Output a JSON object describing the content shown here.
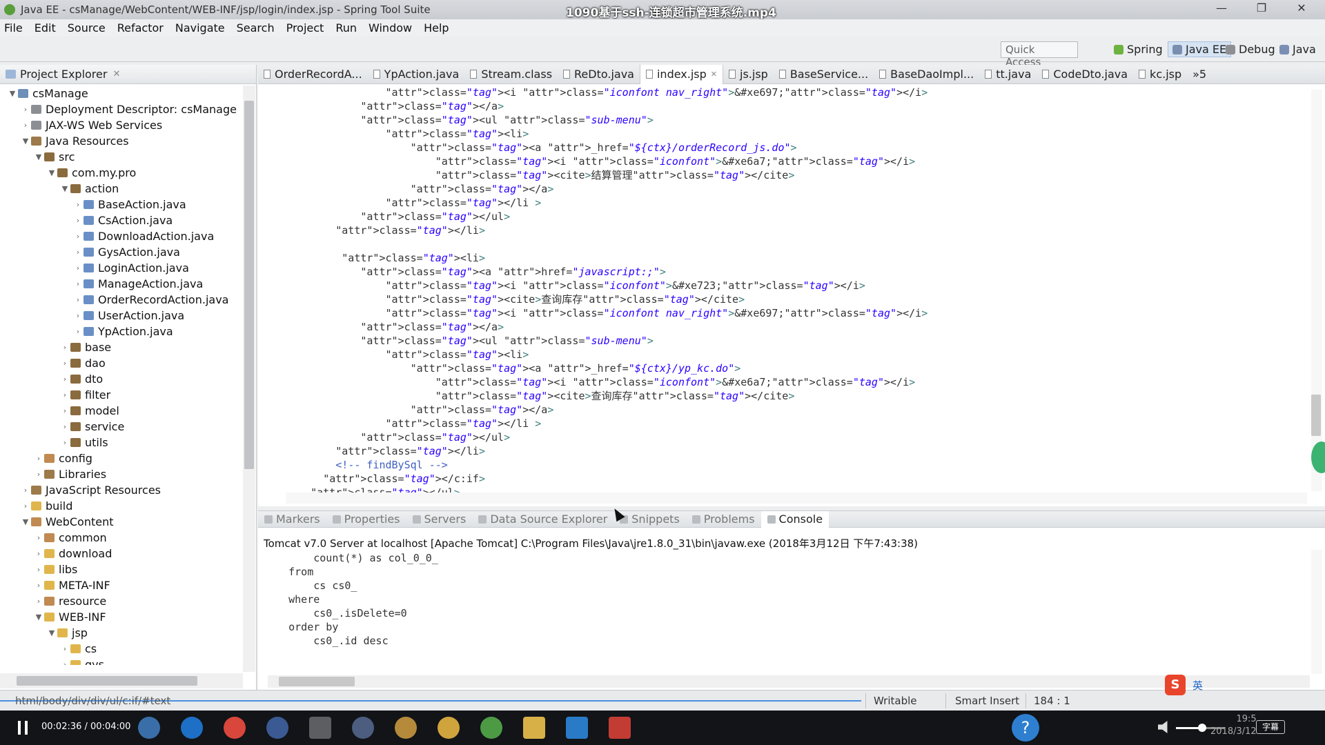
{
  "window": {
    "title": "Java EE - csManage/WebContent/WEB-INF/jsp/login/index.jsp - Spring Tool Suite",
    "video_title": "1090基于ssh-连锁超市管理系统.mp4"
  },
  "menu": [
    "File",
    "Edit",
    "Source",
    "Refactor",
    "Navigate",
    "Search",
    "Project",
    "Run",
    "Window",
    "Help"
  ],
  "toolbar": {
    "quick_access": "Quick Access",
    "perspectives": [
      "Spring",
      "Java EE",
      "Debug",
      "Java"
    ],
    "active_perspective": "Java EE"
  },
  "explorer": {
    "title": "Project Explorer",
    "tree": [
      {
        "label": "csManage",
        "icon": "proj",
        "twisty": "open"
      },
      {
        "label": "Deployment Descriptor: csManage",
        "icon": "dd",
        "twisty": "closed"
      },
      {
        "label": "JAX-WS Web Services",
        "icon": "dd",
        "twisty": "closed"
      },
      {
        "label": "Java Resources",
        "icon": "lib",
        "twisty": "open"
      },
      {
        "label": "src",
        "icon": "pkg",
        "twisty": "open"
      },
      {
        "label": "com.my.pro",
        "icon": "pkg",
        "twisty": "open"
      },
      {
        "label": "action",
        "icon": "pkg",
        "twisty": "open"
      },
      {
        "label": "BaseAction.java",
        "icon": "java",
        "twisty": "closed"
      },
      {
        "label": "CsAction.java",
        "icon": "java",
        "twisty": "closed"
      },
      {
        "label": "DownloadAction.java",
        "icon": "java",
        "twisty": "closed"
      },
      {
        "label": "GysAction.java",
        "icon": "java",
        "twisty": "closed"
      },
      {
        "label": "LoginAction.java",
        "icon": "java",
        "twisty": "closed"
      },
      {
        "label": "ManageAction.java",
        "icon": "java",
        "twisty": "closed"
      },
      {
        "label": "OrderRecordAction.java",
        "icon": "java",
        "twisty": "closed"
      },
      {
        "label": "UserAction.java",
        "icon": "java",
        "twisty": "closed"
      },
      {
        "label": "YpAction.java",
        "icon": "java",
        "twisty": "closed"
      },
      {
        "label": "base",
        "icon": "pkg",
        "twisty": "closed"
      },
      {
        "label": "dao",
        "icon": "pkg",
        "twisty": "closed"
      },
      {
        "label": "dto",
        "icon": "pkg",
        "twisty": "closed"
      },
      {
        "label": "filter",
        "icon": "pkg",
        "twisty": "closed"
      },
      {
        "label": "model",
        "icon": "pkg",
        "twisty": "closed"
      },
      {
        "label": "service",
        "icon": "pkg",
        "twisty": "closed"
      },
      {
        "label": "utils",
        "icon": "pkg",
        "twisty": "closed"
      },
      {
        "label": "config",
        "icon": "res",
        "twisty": "closed"
      },
      {
        "label": "Libraries",
        "icon": "lib",
        "twisty": "closed"
      },
      {
        "label": "JavaScript Resources",
        "icon": "lib",
        "twisty": "closed"
      },
      {
        "label": "build",
        "icon": "fold",
        "twisty": "closed"
      },
      {
        "label": "WebContent",
        "icon": "res",
        "twisty": "open"
      },
      {
        "label": "common",
        "icon": "res",
        "twisty": "closed"
      },
      {
        "label": "download",
        "icon": "fold",
        "twisty": "closed"
      },
      {
        "label": "libs",
        "icon": "fold",
        "twisty": "closed"
      },
      {
        "label": "META-INF",
        "icon": "fold",
        "twisty": "closed"
      },
      {
        "label": "resource",
        "icon": "res",
        "twisty": "closed"
      },
      {
        "label": "WEB-INF",
        "icon": "fold",
        "twisty": "open"
      },
      {
        "label": "jsp",
        "icon": "fold",
        "twisty": "open"
      },
      {
        "label": "cs",
        "icon": "fold",
        "twisty": "closed"
      },
      {
        "label": "gys",
        "icon": "fold",
        "twisty": "closed"
      }
    ]
  },
  "editor": {
    "tabs": [
      "OrderRecordA...",
      "YpAction.java",
      "Stream.class",
      "ReDto.java",
      "index.jsp",
      "js.jsp",
      "BaseService...",
      "BaseDaoImpl...",
      "tt.java",
      "CodeDto.java",
      "kc.jsp"
    ],
    "active_tab": "index.jsp",
    "overflow_count": "»5",
    "code": [
      "                <i class=\"iconfont nav_right\">&#xe697;</i>",
      "            </a>",
      "            <ul class=\"sub-menu\">",
      "                <li>",
      "                    <a _href=\"${ctx}/orderRecord_js.do\">",
      "                        <i class=\"iconfont\">&#xe6a7;</i>",
      "                        <cite>结算管理</cite>",
      "                    </a>",
      "                </li >",
      "            </ul>",
      "        </li>",
      "",
      "         <li>",
      "            <a href=\"javascript:;\">",
      "                <i class=\"iconfont\">&#xe723;</i>",
      "                <cite>查询库存</cite>",
      "                <i class=\"iconfont nav_right\">&#xe697;</i>",
      "            </a>",
      "            <ul class=\"sub-menu\">",
      "                <li>",
      "                    <a _href=\"${ctx}/yp_kc.do\">",
      "                        <i class=\"iconfont\">&#xe6a7;</i>",
      "                        <cite>查询库存</cite>",
      "                    </a>",
      "                </li >",
      "            </ul>",
      "        </li>",
      "        <!-- findBySql -->",
      "      </c:if>",
      "    </ul>"
    ]
  },
  "console": {
    "tabs": [
      "Markers",
      "Properties",
      "Servers",
      "Data Source Explorer",
      "Snippets",
      "Problems",
      "Console"
    ],
    "active_tab": "Console",
    "server": "Tomcat v7.0 Server at localhost [Apache Tomcat] C:\\Program Files\\Java\\jre1.8.0_31\\bin\\javaw.exe (2018年3月12日 下午7:43:38)",
    "output": [
      "        count(*) as col_0_0_",
      "    from",
      "        cs cs0_",
      "    where",
      "        cs0_.isDelete=0",
      "    order by",
      "        cs0_.id desc"
    ]
  },
  "status": {
    "path": "html/body/div/div/ul/c:if/#text",
    "writable": "Writable",
    "insert_mode": "Smart Insert",
    "position": "184 : 1"
  },
  "player": {
    "time": "00:02:36 / 00:04:00",
    "volume_percent": 45,
    "progress_percent": 65,
    "subtitle_btn": "字幕",
    "clock": "19:5",
    "date": "2018/3/12"
  },
  "ime": {
    "lang": "英"
  }
}
